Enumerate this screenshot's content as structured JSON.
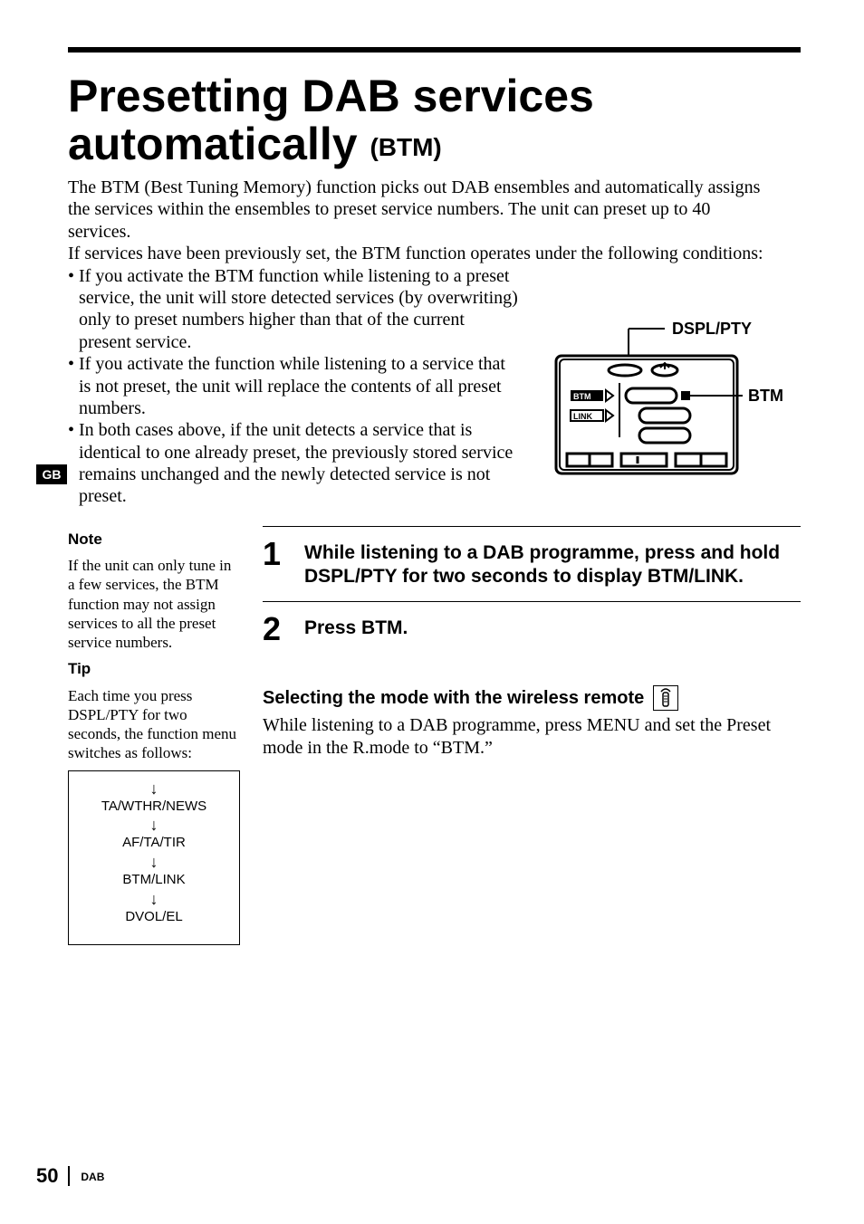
{
  "title_main": "Presetting DAB services automatically ",
  "title_sub": "(BTM)",
  "intro_p1": "The BTM (Best Tuning Memory) function picks out DAB ensembles and automatically assigns the services within the ensembles to preset service numbers. The unit can preset up to 40 services.",
  "intro_p2": "If services have been previously set, the BTM function operates under the following conditions:",
  "bullets": {
    "b1": "• If you activate the BTM function while listening to a preset service, the unit will store detected services (by overwriting) only to preset numbers higher than that of the current present service.",
    "b2": "• If you activate the function while listening to a service that is not preset, the unit will replace the contents of all preset numbers.",
    "b3": "• In both cases above, if the unit detects a service that is identical to one already preset, the previously stored service remains unchanged and the newly detected service is not preset."
  },
  "diagram": {
    "label_dsplpty": "DSPL/PTY",
    "label_btm": "BTM",
    "chip_btm": "BTM",
    "chip_link": "LINK"
  },
  "gb_tab": "GB",
  "sidebar": {
    "note_h": "Note",
    "note_body": "If the unit can only tune in a few services, the BTM function may not assign services to all the preset service numbers.",
    "tip_h": "Tip",
    "tip_body": "Each time you press DSPL/PTY for two seconds, the function menu switches as follows:",
    "flow": [
      "TA/WTHR/NEWS",
      "AF/TA/TIR",
      "BTM/LINK",
      "DVOL/EL"
    ]
  },
  "steps": {
    "s1_num": "1",
    "s1_body": "While listening to a DAB programme, press and hold DSPL/PTY for two seconds to display BTM/LINK.",
    "s2_num": "2",
    "s2_body": "Press BTM."
  },
  "remote": {
    "heading": "Selecting the mode with the wireless remote",
    "body": "While listening to a DAB programme, press MENU and set the Preset mode in the R.mode to “BTM.”"
  },
  "footer": {
    "page": "50",
    "section": "DAB"
  }
}
